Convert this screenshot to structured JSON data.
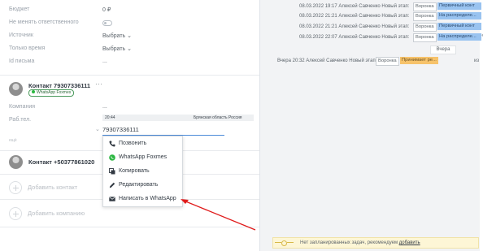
{
  "fields": {
    "budget_label": "Бюджет",
    "budget_value": "0 ₽",
    "no_change_label": "Не менять ответственного",
    "source_label": "Источник",
    "source_value": "Выбрать",
    "only_time_label": "Только время",
    "only_time_value": "Выбрать",
    "letter_id_label": "Id письма",
    "letter_id_value": "..."
  },
  "contact1": {
    "name": "Контакт 79307336111",
    "badge": "WhatsApp Foxmes",
    "company_label": "Компания",
    "company_value": "...",
    "work_phone_label": "Раб.тел.",
    "phone_hint_time": "20:44",
    "phone_hint_region": "Брянская область Россия",
    "phone_value": "79307336111",
    "tiny_label": "ещё"
  },
  "context_menu": {
    "items": [
      {
        "label": "Позвонить",
        "icon": "phone-icon"
      },
      {
        "label": "WhatsApp Foxmes",
        "icon": "whatsapp-icon"
      },
      {
        "label": "Копировать",
        "icon": "copy-icon"
      },
      {
        "label": "Редактировать",
        "icon": "pencil-icon"
      },
      {
        "label": "Написать в WhatsApp",
        "icon": "envelope-icon"
      }
    ]
  },
  "contact2": {
    "name": "Контакт +50377861020"
  },
  "add": {
    "contact_label": "Добавить контакт",
    "company_label": "Добавить компанию"
  },
  "feed": {
    "rows": [
      {
        "text": "08.03.2022 19:17 Алексей Савченко Новый этап:",
        "pipeline": "Воронка",
        "stage": "Первичный конт"
      },
      {
        "text": "08.03.2022 21:21 Алексей Савченко Новый этап:",
        "pipeline": "Воронка",
        "stage": "На распределе..."
      },
      {
        "text": "08.03.2022 21:21 Алексей Савченко Новый этап:",
        "pipeline": "Воронка",
        "stage": "Первичный конт"
      },
      {
        "text": "08.03.2022 22:07 Алексей Савченко Новый этап:",
        "pipeline": "Воронка",
        "stage": "На распределе..."
      }
    ],
    "day_chip": "Вчера",
    "last_row": {
      "text": "Вчера 20:32 Алексей Савченко Новый этап:",
      "pipeline": "Воронка",
      "stage": "Принимает ре...",
      "tail": "из"
    }
  },
  "tasks": {
    "text": "Нет запланированных задач, рекомендуем",
    "link": "добавить"
  },
  "colors": {
    "stage_blue": "#99c3f0",
    "stage_orange": "#f7c36b",
    "whatsapp_green": "#2bb741",
    "annotation_red": "#e01b1b"
  }
}
